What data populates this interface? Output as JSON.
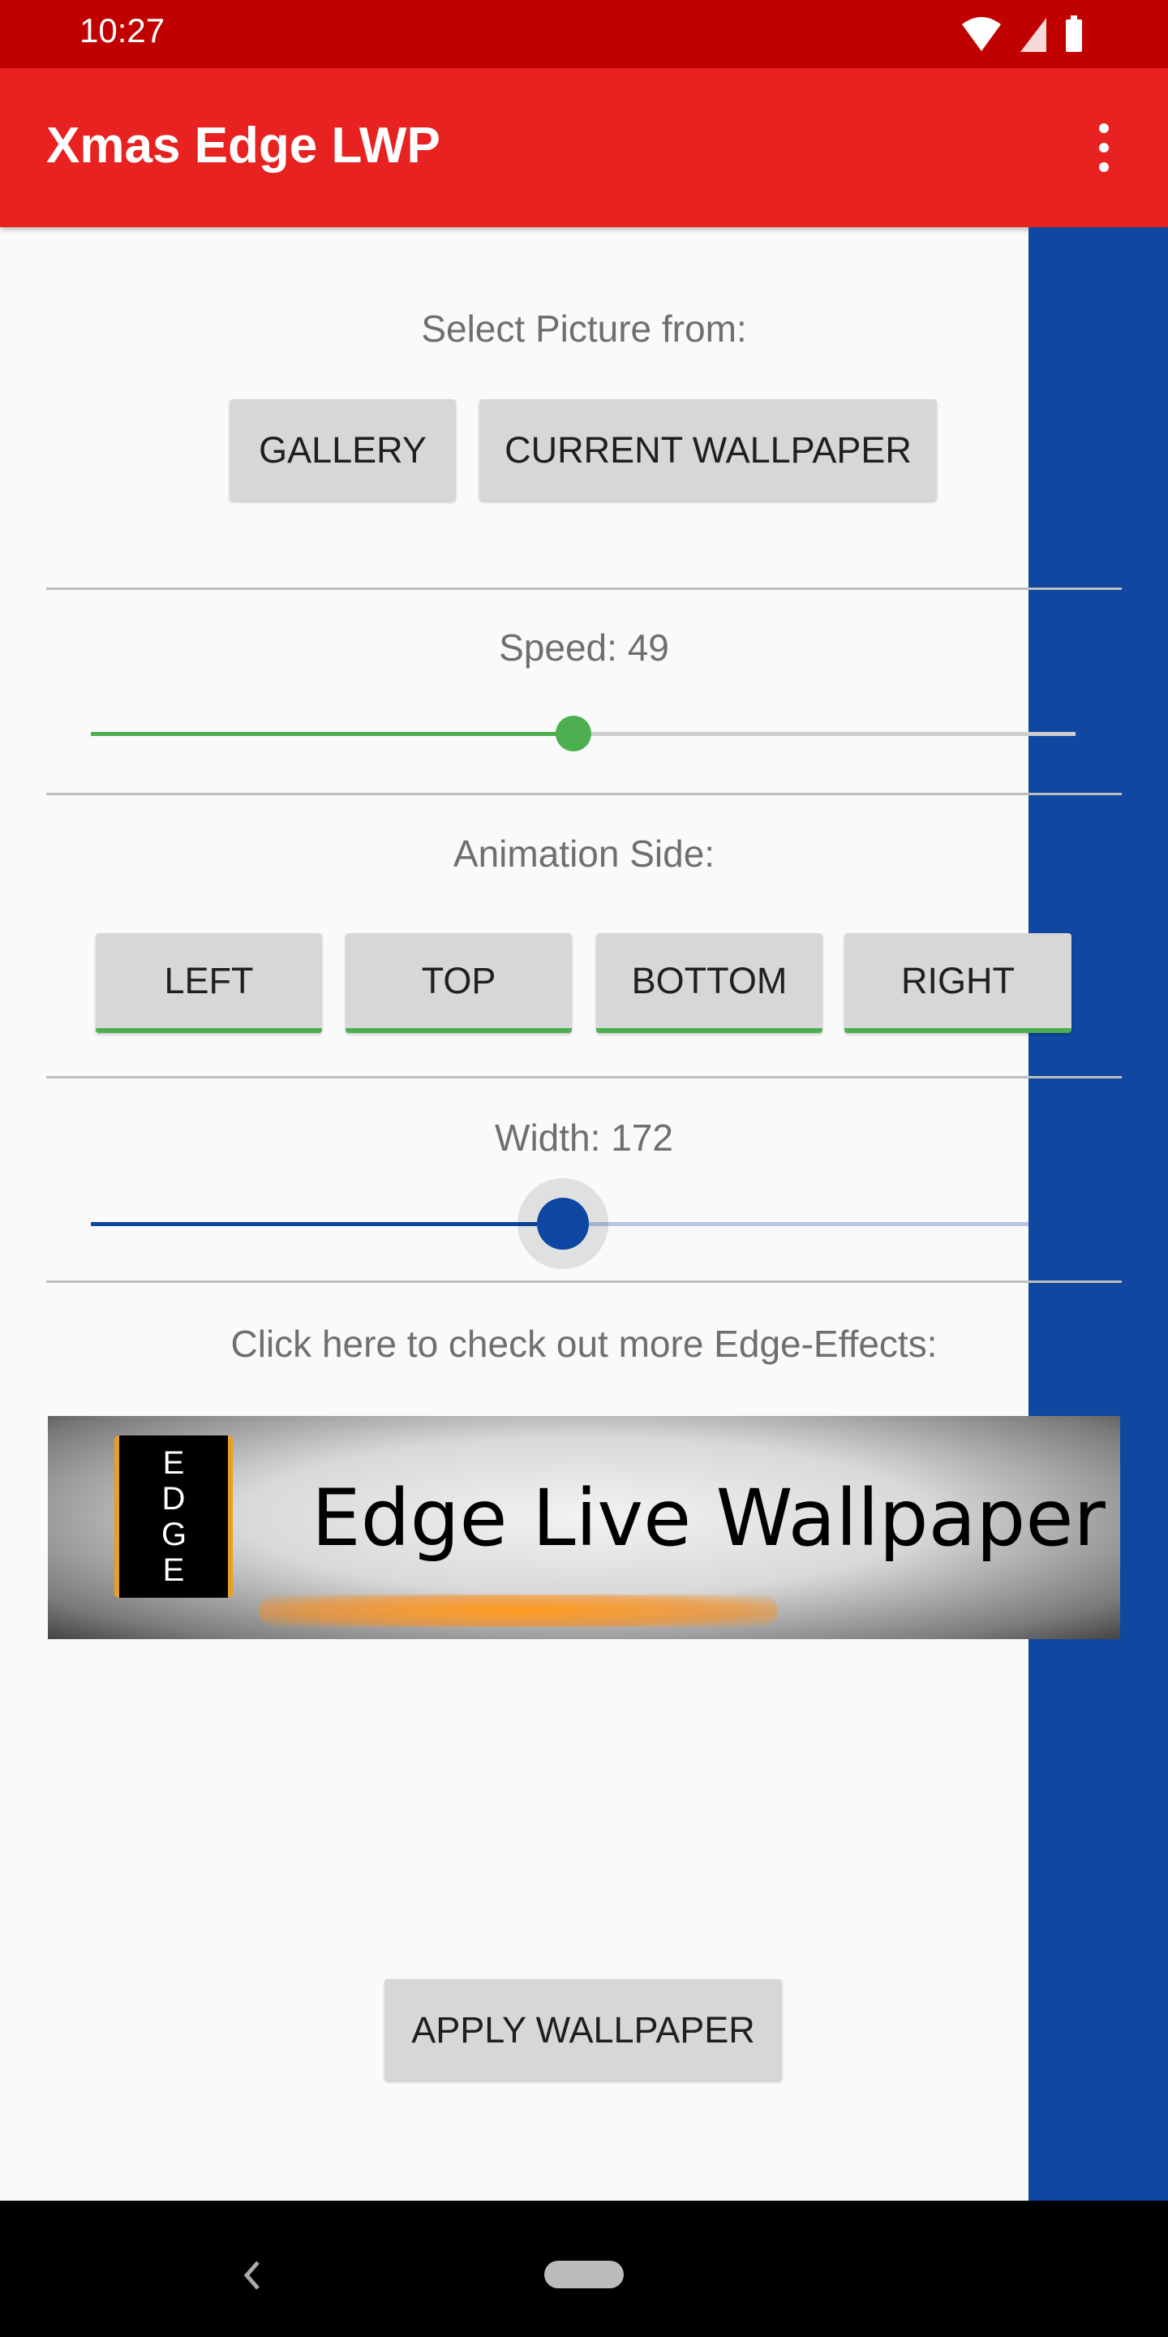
{
  "status_bar": {
    "time": "10:27",
    "icons": [
      "wifi-icon",
      "signal-icon",
      "battery-icon"
    ]
  },
  "app_bar": {
    "title": "Xmas Edge LWP",
    "menu_icon": "more-vert-icon"
  },
  "picture": {
    "label": "Select Picture from:",
    "gallery": "GALLERY",
    "current": "CURRENT WALLPAPER"
  },
  "speed": {
    "label": "Speed: 49",
    "value": 49,
    "fraction": 0.49,
    "color": "#4caf50"
  },
  "animation_side": {
    "label": "Animation Side:",
    "buttons": [
      "LEFT",
      "TOP",
      "BOTTOM",
      "RIGHT"
    ]
  },
  "width": {
    "label": "Width: 172",
    "value": 172,
    "fraction": 0.47,
    "color": "#0d47a1"
  },
  "more": {
    "label": "Click here to check out more Edge-Effects:",
    "banner_text": "Edge Live Wallpaper",
    "banner_logo": "EDGE"
  },
  "apply": {
    "label": "APPLY WALLPAPER"
  },
  "colors": {
    "status": "#c10000",
    "appbar": "#e82121",
    "strip": "#0f47a1"
  }
}
